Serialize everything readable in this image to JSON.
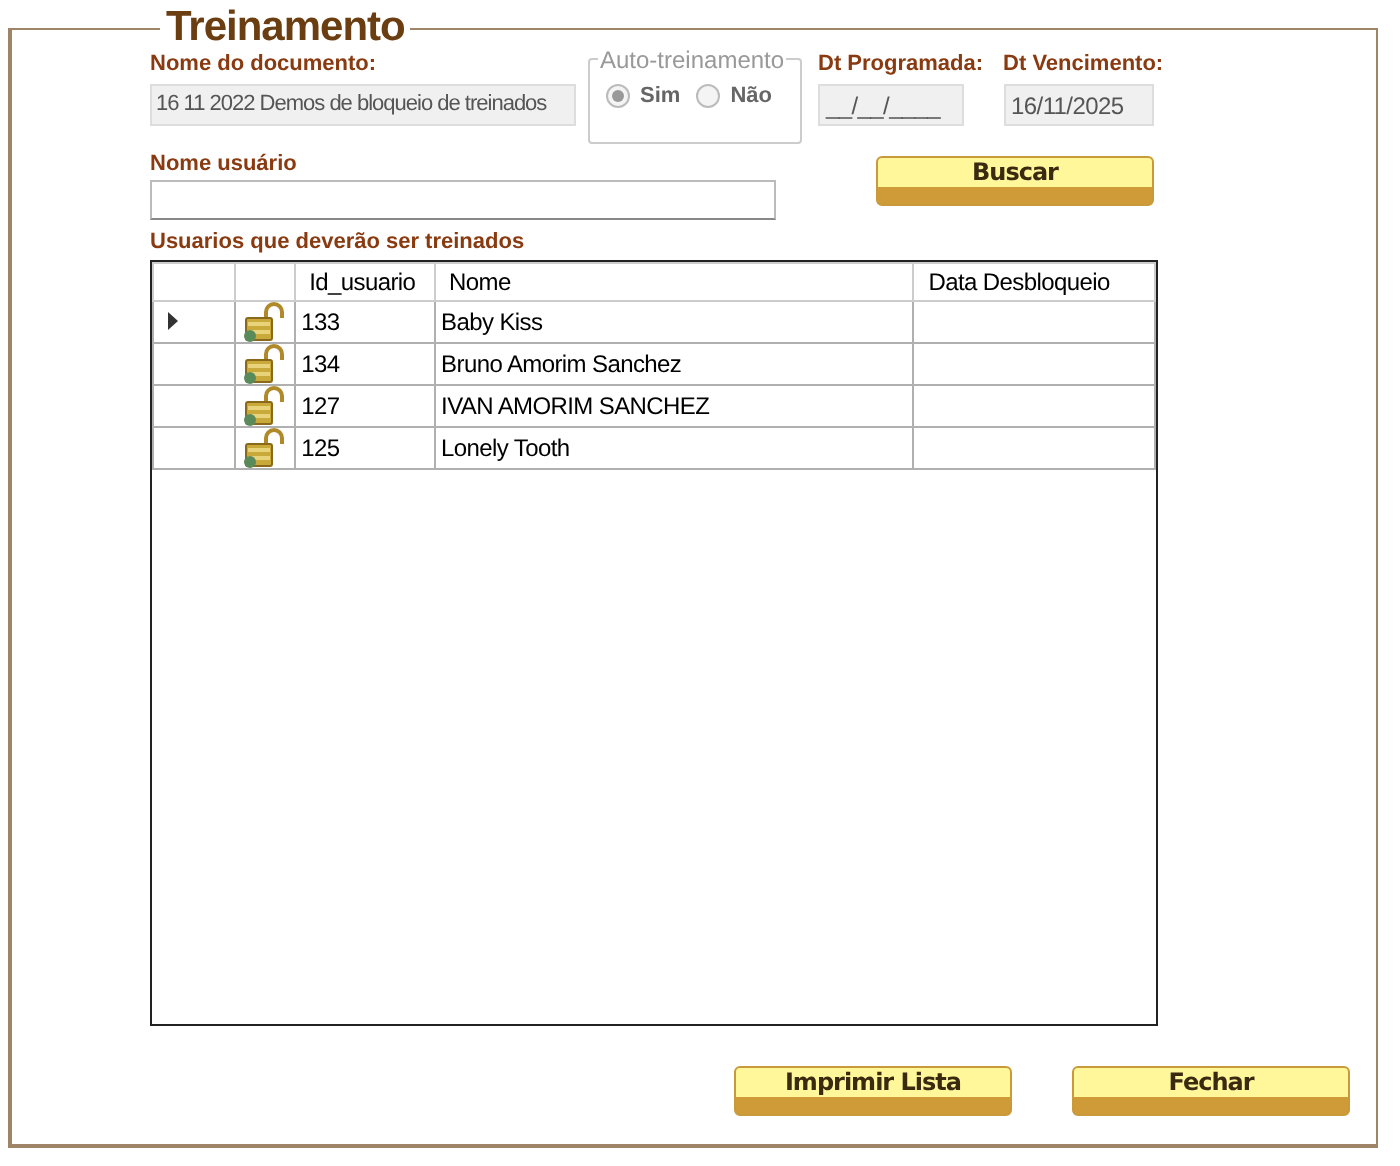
{
  "form": {
    "title": "Treinamento"
  },
  "document": {
    "label": "Nome do documento:",
    "value": "16 11 2022 Demos de bloqueio de treinados"
  },
  "auto_training": {
    "legend": "Auto-treinamento",
    "disabled": true,
    "options": [
      {
        "label": "Sim",
        "selected": true
      },
      {
        "label": "Não",
        "selected": false
      }
    ]
  },
  "scheduled_date": {
    "label": "Dt Programada:",
    "value": "__/__/____"
  },
  "due_date": {
    "label": "Dt Vencimento:",
    "value": "16/11/2025"
  },
  "user_name": {
    "label": "Nome usuário"
  },
  "search_button": "Buscar",
  "table": {
    "label": "Usuarios que deverão ser treinados",
    "columns": [
      "Id_usuario",
      "Nome",
      "Data Desbloqueio"
    ],
    "rows": [
      {
        "id": "133",
        "name": "Baby Kiss",
        "selected": true
      },
      {
        "id": "134",
        "name": "Bruno Amorim Sanchez",
        "selected": false
      },
      {
        "id": "127",
        "name": "IVAN AMORIM SANCHEZ",
        "selected": false
      },
      {
        "id": "125",
        "name": "Lonely Tooth",
        "selected": false
      }
    ]
  },
  "buttons": [
    "Imprimir Lista",
    "Fechar"
  ]
}
